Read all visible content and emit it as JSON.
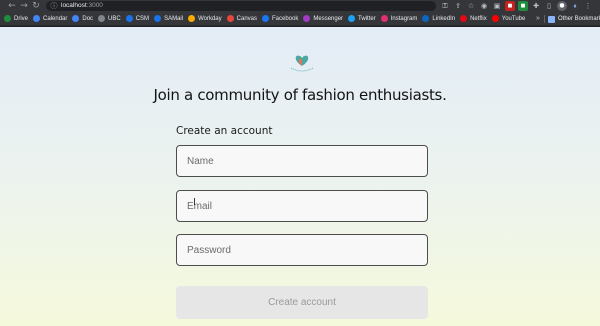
{
  "browser": {
    "url_host": "localhost",
    "url_port": ":3000",
    "bookmarks": [
      {
        "label": "Drive",
        "color": "#1e8e3e"
      },
      {
        "label": "Calendar",
        "color": "#4285f4"
      },
      {
        "label": "Doc",
        "color": "#4285f4"
      },
      {
        "label": "UBC",
        "color": "#80868b"
      },
      {
        "label": "CSM",
        "color": "#1a73e8"
      },
      {
        "label": "SAMail",
        "color": "#1a73e8"
      },
      {
        "label": "Workday",
        "color": "#f9ab00"
      },
      {
        "label": "Canvas",
        "color": "#e8453c"
      },
      {
        "label": "Facebook",
        "color": "#1877f2"
      },
      {
        "label": "Messenger",
        "color": "#a33bc2"
      },
      {
        "label": "Twitter",
        "color": "#1da1f2"
      },
      {
        "label": "Instagram",
        "color": "#e1306c"
      },
      {
        "label": "LinkedIn",
        "color": "#0a66c2"
      },
      {
        "label": "Netflix",
        "color": "#e50914"
      },
      {
        "label": "YouTube",
        "color": "#ff0000"
      }
    ],
    "more_label": "»",
    "other_bookmarks_label": "Other Bookmarks"
  },
  "page": {
    "headline": "Join a community of fashion enthusiasts.",
    "form_title": "Create an account",
    "name_placeholder": "Name",
    "email_placeholder": "Email",
    "password_placeholder": "Password",
    "submit_label": "Create account"
  },
  "colors": {
    "accent_teal": "#4aa8a0",
    "logo_heart": "#e2745c"
  }
}
